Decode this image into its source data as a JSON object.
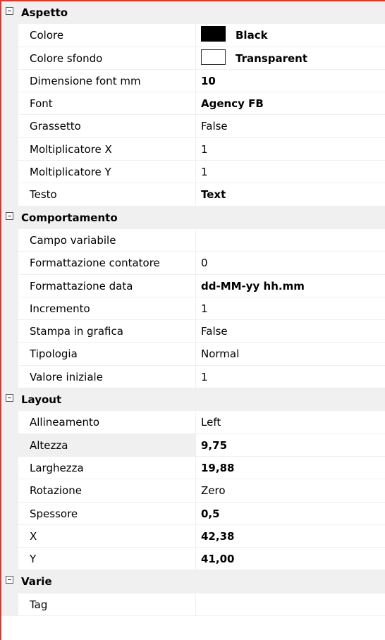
{
  "categories": {
    "aspetto": {
      "label": "Aspetto",
      "props": {
        "colore": {
          "name": "Colore",
          "value": "Black",
          "swatch": "#000000"
        },
        "colore_sfondo": {
          "name": "Colore sfondo",
          "value": "Transparent",
          "swatch": "#ffffff"
        },
        "dimensione_font": {
          "name": "Dimensione font mm",
          "value": "10"
        },
        "font": {
          "name": "Font",
          "value": "Agency FB"
        },
        "grassetto": {
          "name": "Grassetto",
          "value": "False"
        },
        "molt_x": {
          "name": "Moltiplicatore X",
          "value": "1"
        },
        "molt_y": {
          "name": "Moltiplicatore Y",
          "value": "1"
        },
        "testo": {
          "name": "Testo",
          "value": "Text"
        }
      }
    },
    "comportamento": {
      "label": "Comportamento",
      "props": {
        "campo_variabile": {
          "name": "Campo variabile",
          "value": ""
        },
        "form_contatore": {
          "name": "Formattazione contatore",
          "value": "0"
        },
        "form_data": {
          "name": "Formattazione data",
          "value": "dd-MM-yy hh.mm"
        },
        "incremento": {
          "name": "Incremento",
          "value": "1"
        },
        "stampa_grafica": {
          "name": "Stampa in grafica",
          "value": "False"
        },
        "tipologia": {
          "name": "Tipologia",
          "value": "Normal"
        },
        "valore_iniziale": {
          "name": "Valore iniziale",
          "value": "1"
        }
      }
    },
    "layout": {
      "label": "Layout",
      "props": {
        "allineamento": {
          "name": "Allineamento",
          "value": "Left"
        },
        "altezza": {
          "name": "Altezza",
          "value": "9,75"
        },
        "larghezza": {
          "name": "Larghezza",
          "value": "19,88"
        },
        "rotazione": {
          "name": "Rotazione",
          "value": "Zero"
        },
        "spessore": {
          "name": "Spessore",
          "value": "0,5"
        },
        "x": {
          "name": "X",
          "value": "42,38"
        },
        "y": {
          "name": "Y",
          "value": "41,00"
        }
      }
    },
    "varie": {
      "label": "Varie",
      "props": {
        "tag": {
          "name": "Tag",
          "value": ""
        }
      }
    }
  },
  "colors": {
    "window_edge": "#d83a2c",
    "category_bg": "#f0f0f0",
    "selected_bg": "#f0f0f0"
  },
  "icons": {
    "collapse": "minus-box-icon"
  }
}
